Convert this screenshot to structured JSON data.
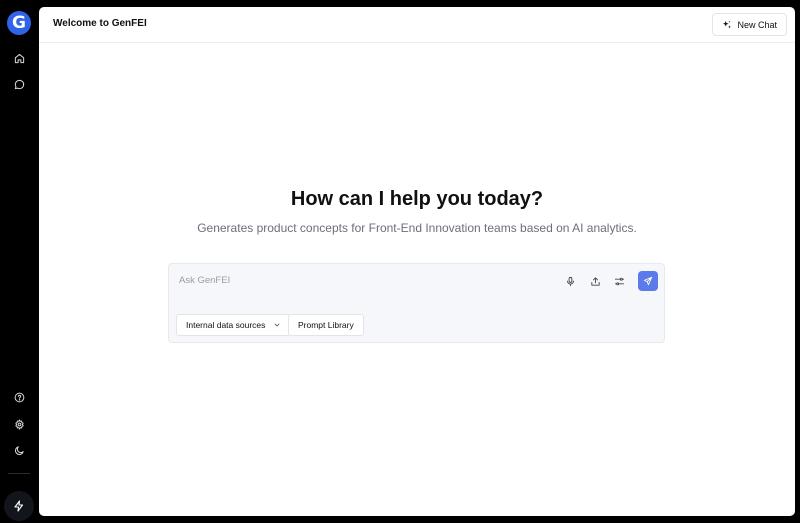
{
  "app": {
    "logo_letter": "G",
    "brand_color": "#2f63e8",
    "accent_color": "#5b7be9"
  },
  "sidebar": {
    "top_items": [
      {
        "icon": "home-icon"
      },
      {
        "icon": "chat-bubble-icon"
      }
    ],
    "bottom_items": [
      {
        "icon": "help-circle-icon"
      },
      {
        "icon": "settings-gear-icon"
      },
      {
        "icon": "moon-icon"
      }
    ],
    "footer_icon": "lightning-bolt-icon"
  },
  "header": {
    "title": "Welcome to GenFEI",
    "new_chat_label": "New Chat",
    "new_chat_icon": "sparkle-icon"
  },
  "hero": {
    "title": "How can I help you today?",
    "subtitle": "Generates product concepts for Front-End Innovation teams based on AI analytics."
  },
  "prompt": {
    "placeholder": "Ask GenFEI",
    "value": "",
    "tools": [
      "microphone-icon",
      "upload-icon",
      "sliders-icon",
      "send-icon"
    ],
    "data_source_label": "Internal data sources",
    "prompt_library_label": "Prompt Library"
  }
}
